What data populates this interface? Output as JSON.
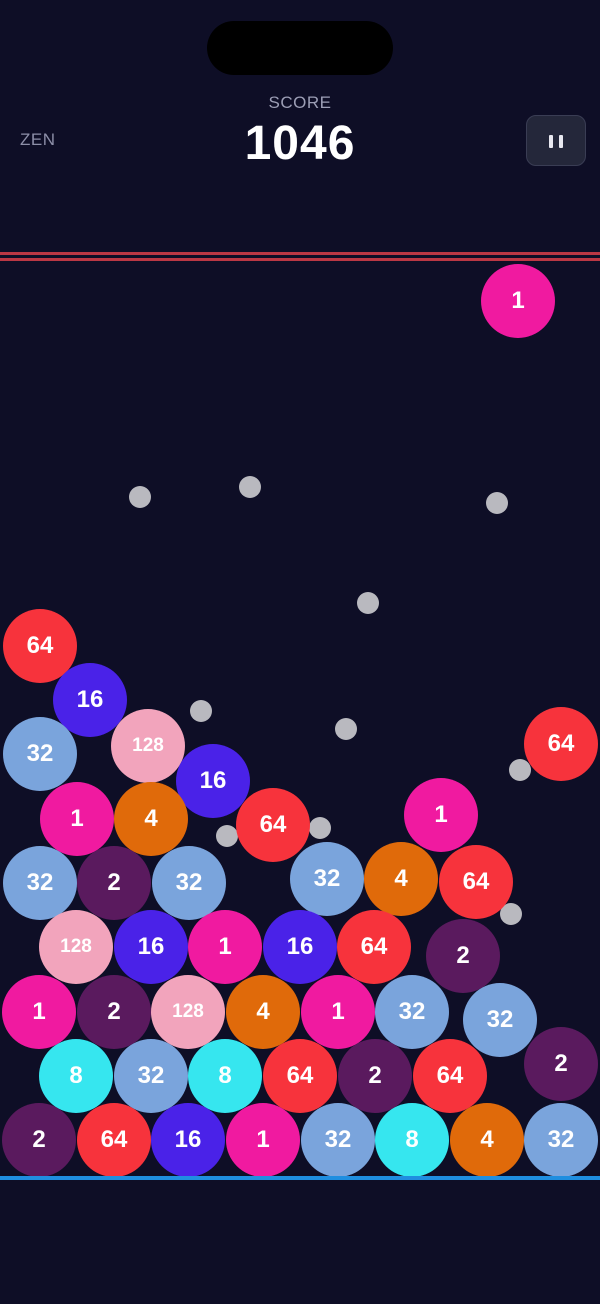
{
  "header": {
    "mode_label": "ZEN",
    "score_label": "SCORE",
    "score_value": "1046",
    "pause_icon": "pause-icon"
  },
  "colors": {
    "1": "#f01aa0",
    "2": "#5a1a5e",
    "4": "#e06a0a",
    "8": "#36e6ef",
    "16": "#4a22e8",
    "32": "#7aa4dc",
    "64": "#f7333c",
    "128": "#f2a4bc",
    "peg": "#b9b9bf",
    "danger_line": "#c53a46",
    "floor_line": "#1f8ee0",
    "background": "#0e0e26"
  },
  "active_ball": {
    "value": "1"
  },
  "balls": [
    {
      "value": "1"
    },
    {
      "value": "64"
    },
    {
      "value": "16"
    },
    {
      "value": "32"
    },
    {
      "value": "128"
    },
    {
      "value": "64"
    },
    {
      "value": "16"
    },
    {
      "value": "1"
    },
    {
      "value": "4"
    },
    {
      "value": "64"
    },
    {
      "value": "1"
    },
    {
      "value": "32"
    },
    {
      "value": "2"
    },
    {
      "value": "32"
    },
    {
      "value": "32"
    },
    {
      "value": "4"
    },
    {
      "value": "64"
    },
    {
      "value": "128"
    },
    {
      "value": "16"
    },
    {
      "value": "1"
    },
    {
      "value": "16"
    },
    {
      "value": "64"
    },
    {
      "value": "2"
    },
    {
      "value": "1"
    },
    {
      "value": "2"
    },
    {
      "value": "128"
    },
    {
      "value": "4"
    },
    {
      "value": "1"
    },
    {
      "value": "32"
    },
    {
      "value": "32"
    },
    {
      "value": "8"
    },
    {
      "value": "32"
    },
    {
      "value": "8"
    },
    {
      "value": "64"
    },
    {
      "value": "2"
    },
    {
      "value": "64"
    },
    {
      "value": "2"
    },
    {
      "value": "2"
    },
    {
      "value": "64"
    },
    {
      "value": "16"
    },
    {
      "value": "1"
    },
    {
      "value": "32"
    },
    {
      "value": "8"
    },
    {
      "value": "4"
    },
    {
      "value": "32"
    }
  ],
  "pegs": 12
}
